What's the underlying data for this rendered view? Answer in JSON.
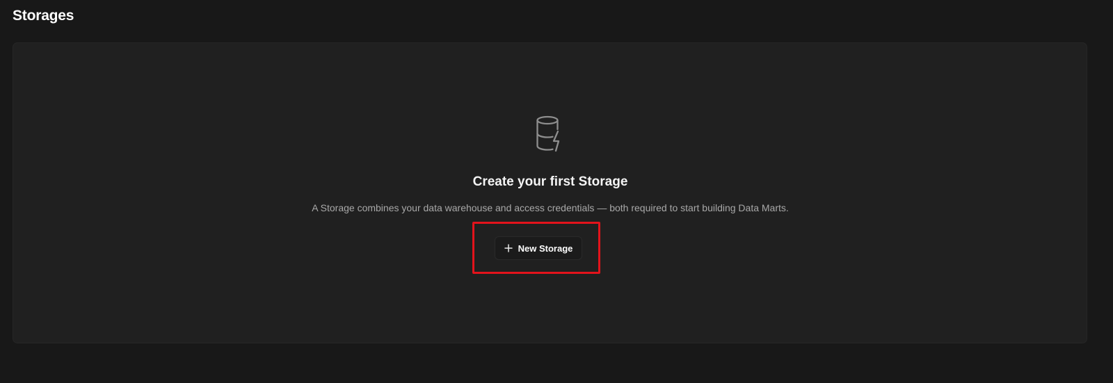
{
  "page": {
    "title": "Storages"
  },
  "empty_state": {
    "icon": "database-lightning-icon",
    "title": "Create your first Storage",
    "description": "A Storage combines your data warehouse and access credentials — both required to start building Data Marts.",
    "button": {
      "icon": "plus-icon",
      "label": "New Storage"
    }
  },
  "colors": {
    "background": "#181818",
    "card": "#202020",
    "highlight": "#e3131b"
  }
}
